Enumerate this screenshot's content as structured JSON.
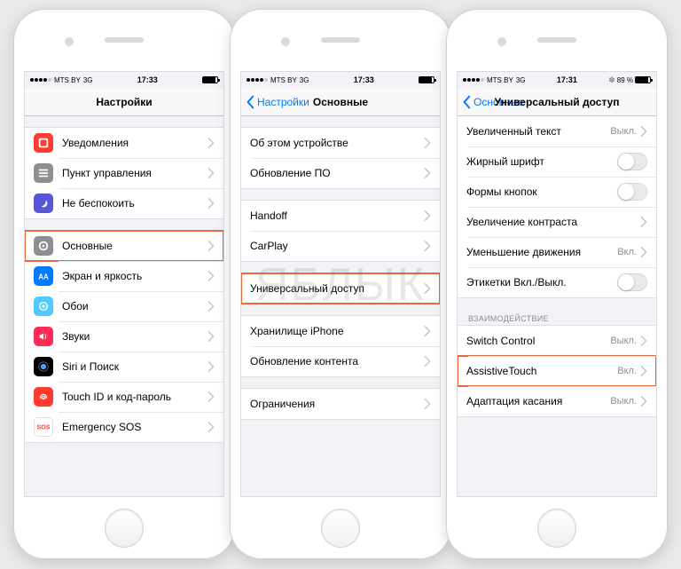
{
  "watermark": "ЯБЛЫК",
  "phone1": {
    "status": {
      "carrier": "MTS BY",
      "net": "3G",
      "time": "17:33"
    },
    "nav": {
      "title": "Настройки"
    },
    "g1": [
      {
        "icon": "notif",
        "bg": "#ff3b30",
        "label": "Уведомления"
      },
      {
        "icon": "control",
        "bg": "#8e8e93",
        "label": "Пункт управления"
      },
      {
        "icon": "dnd",
        "bg": "#5856d6",
        "label": "Не беспокоить"
      }
    ],
    "g2": [
      {
        "icon": "general",
        "bg": "#8e8e93",
        "label": "Основные",
        "hl": true
      },
      {
        "icon": "display",
        "bg": "#007aff",
        "label": "Экран и яркость"
      },
      {
        "icon": "wall",
        "bg": "#54c7fc",
        "label": "Обои"
      },
      {
        "icon": "sounds",
        "bg": "#ff2d55",
        "label": "Звуки"
      },
      {
        "icon": "siri",
        "bg": "#000",
        "label": "Siri и Поиск"
      },
      {
        "icon": "touchid",
        "bg": "#ff3b30",
        "label": "Touch ID и код-пароль"
      },
      {
        "icon": "sos",
        "bg": "#fff",
        "label": "Emergency SOS",
        "textcolor": "#ff3b30"
      }
    ]
  },
  "phone2": {
    "status": {
      "carrier": "MTS BY",
      "net": "3G",
      "time": "17:33"
    },
    "nav": {
      "back": "Настройки",
      "title": "Основные"
    },
    "g1": [
      "Об этом устройстве",
      "Обновление ПО"
    ],
    "g2": [
      "Handoff",
      "CarPlay"
    ],
    "g3": [
      {
        "label": "Универсальный доступ",
        "hl": true
      }
    ],
    "g4": [
      "Хранилище iPhone",
      "Обновление контента"
    ],
    "g5": [
      "Ограничения"
    ]
  },
  "phone3": {
    "status": {
      "carrier": "MTS BY",
      "net": "3G",
      "time": "17:31",
      "batt": "89 %"
    },
    "nav": {
      "back": "Основные",
      "title": "Универсальный доступ"
    },
    "g1": [
      {
        "label": "Увеличенный текст",
        "value": "Выкл.",
        "chev": true
      },
      {
        "label": "Жирный шрифт",
        "toggle": true
      },
      {
        "label": "Формы кнопок",
        "toggle": true
      },
      {
        "label": "Увеличение контраста",
        "chev": true
      },
      {
        "label": "Уменьшение движения",
        "value": "Вкл.",
        "chev": true
      },
      {
        "label": "Этикетки Вкл./Выкл.",
        "toggle": true
      }
    ],
    "g2h": "ВЗАИМОДЕЙСТВИЕ",
    "g2": [
      {
        "label": "Switch Control",
        "value": "Выкл.",
        "chev": true
      },
      {
        "label": "AssistiveTouch",
        "value": "Вкл.",
        "chev": true,
        "hl": true
      },
      {
        "label": "Адаптация касания",
        "value": "Выкл.",
        "chev": true
      }
    ]
  }
}
